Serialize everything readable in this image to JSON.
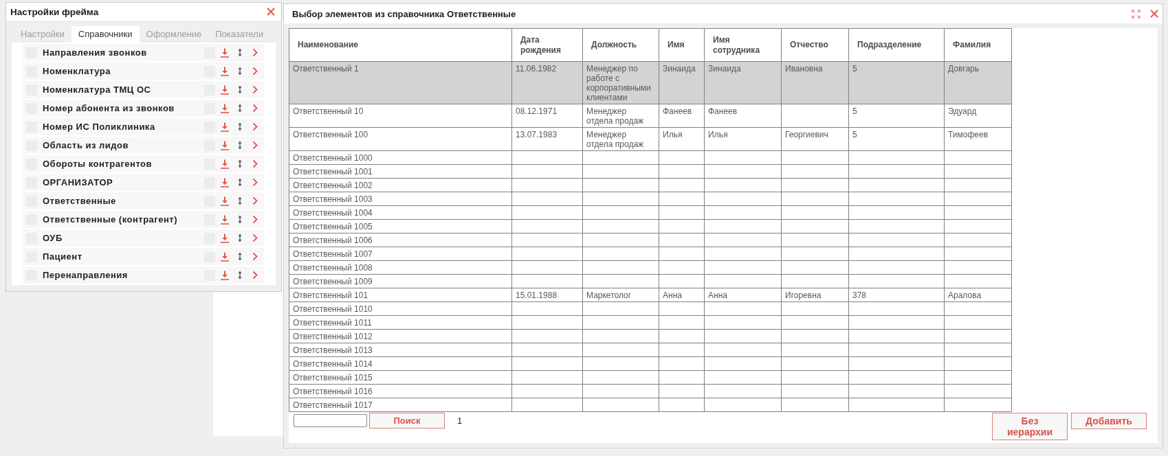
{
  "frame_settings": {
    "title": "Настройки фрейма",
    "tabs": [
      {
        "label": "Настройки",
        "selected": false
      },
      {
        "label": "Справочники",
        "selected": true
      },
      {
        "label": "Оформление",
        "selected": false
      },
      {
        "label": "Показатели",
        "selected": false
      }
    ],
    "catalogs": [
      {
        "name": "Направления звонков",
        "checked": false,
        "option_checked": false
      },
      {
        "name": "Номенклатура",
        "checked": false,
        "option_checked": false
      },
      {
        "name": "Номенклатура ТМЦ ОС",
        "checked": false,
        "option_checked": false
      },
      {
        "name": "Номер абонента из звонков",
        "checked": false,
        "option_checked": false
      },
      {
        "name": "Номер ИС Поликлиника",
        "checked": false,
        "option_checked": false
      },
      {
        "name": "Область из лидов",
        "checked": false,
        "option_checked": false
      },
      {
        "name": "Обороты контрагентов",
        "checked": false,
        "option_checked": false
      },
      {
        "name": "ОРГАНИЗАТОР",
        "checked": false,
        "option_checked": false
      },
      {
        "name": "Ответственные",
        "checked": false,
        "option_checked": false
      },
      {
        "name": "Ответственные (контрагент)",
        "checked": false,
        "option_checked": false
      },
      {
        "name": "ОУБ",
        "checked": false,
        "option_checked": false
      },
      {
        "name": "Пациент",
        "checked": false,
        "option_checked": false
      },
      {
        "name": "Перенаправления",
        "checked": false,
        "option_checked": false
      }
    ]
  },
  "selection_dialog": {
    "title": "Выбор элементов из справочника Ответственные",
    "table": {
      "columns": [
        "Наименование",
        "Дата рождения",
        "Должность",
        "Имя",
        "Имя сотрудника",
        "Отчество",
        "Подразделение",
        "Фамилия"
      ],
      "rows": [
        {
          "name": "Ответственный 1",
          "birth_date": "11.06.1982",
          "position": "Менеджер по работе с корпоративными клиентами",
          "first_name": "Зинаида",
          "employee_name": "Зинаида",
          "patronymic": "Ивановна",
          "department": "5",
          "last_name": "Довгарь",
          "selected": true
        },
        {
          "name": "Ответственный 10",
          "birth_date": "08.12.1971",
          "position": "Менеджер отдела продаж",
          "first_name": "Фанеев",
          "employee_name": "Фанеев",
          "department": "5",
          "last_name": "Эдуард",
          "selected": false
        },
        {
          "name": "Ответственный 100",
          "birth_date": "13.07.1983",
          "position": "Менеджер отдела продаж",
          "first_name": "Илья",
          "employee_name": "Илья",
          "patronymic": "Георгиевич",
          "department": "5",
          "last_name": "Тимофеев",
          "selected": false
        },
        {
          "name": "Ответственный 1000",
          "selected": false
        },
        {
          "name": "Ответственный 1001",
          "selected": false
        },
        {
          "name": "Ответственный 1002",
          "selected": false
        },
        {
          "name": "Ответственный 1003",
          "selected": false
        },
        {
          "name": "Ответственный 1004",
          "selected": false
        },
        {
          "name": "Ответственный 1005",
          "selected": false
        },
        {
          "name": "Ответственный 1006",
          "selected": false
        },
        {
          "name": "Ответственный 1007",
          "selected": false
        },
        {
          "name": "Ответственный 1008",
          "selected": false
        },
        {
          "name": "Ответственный 1009",
          "selected": false
        },
        {
          "name": "Ответственный 101",
          "birth_date": "15.01.1988",
          "position": "Маркетолог",
          "first_name": "Анна",
          "employee_name": "Анна",
          "patronymic": "Игоревна",
          "department": "378",
          "last_name": "Аралова",
          "selected": false
        },
        {
          "name": "Ответственный 1010",
          "selected": false
        },
        {
          "name": "Ответственный 1011",
          "selected": false
        },
        {
          "name": "Ответственный 1012",
          "selected": false
        },
        {
          "name": "Ответственный 1013",
          "selected": false
        },
        {
          "name": "Ответственный 1014",
          "selected": false
        },
        {
          "name": "Ответственный 1015",
          "selected": false
        },
        {
          "name": "Ответственный 1016",
          "selected": false
        },
        {
          "name": "Ответственный 1017",
          "selected": false
        }
      ]
    },
    "search_button": "Поиск",
    "page_number": "1",
    "buttons": [
      "Без иерархии",
      "Добавить"
    ]
  }
}
